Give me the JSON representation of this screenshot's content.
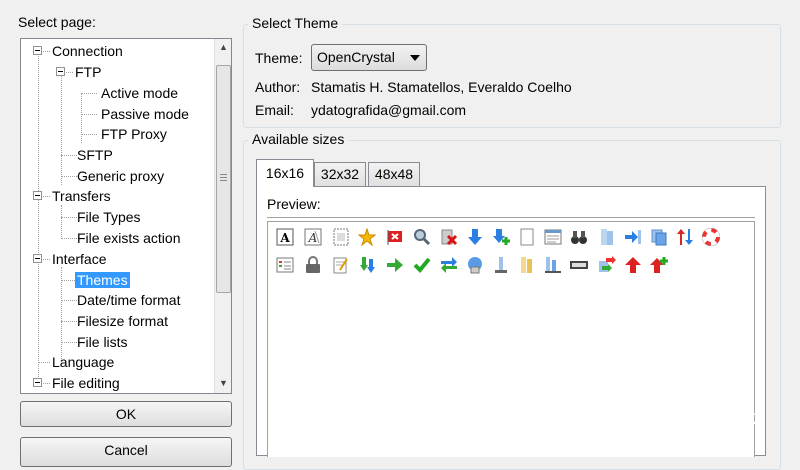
{
  "left": {
    "select_page_label": "Select page:",
    "tree": [
      {
        "label": "Connection"
      },
      {
        "label": "FTP"
      },
      {
        "label": "Active mode"
      },
      {
        "label": "Passive mode"
      },
      {
        "label": "FTP Proxy"
      },
      {
        "label": "SFTP"
      },
      {
        "label": "Generic proxy"
      },
      {
        "label": "Transfers"
      },
      {
        "label": "File Types"
      },
      {
        "label": "File exists action"
      },
      {
        "label": "Interface"
      },
      {
        "label": "Themes"
      },
      {
        "label": "Date/time format"
      },
      {
        "label": "Filesize format"
      },
      {
        "label": "File lists"
      },
      {
        "label": "Language"
      },
      {
        "label": "File editing"
      }
    ],
    "ok_label": "OK",
    "cancel_label": "Cancel"
  },
  "select_theme": {
    "group_title": "Select Theme",
    "theme_label": "Theme:",
    "theme_value": "OpenCrystal",
    "author_label": "Author:",
    "author_value": "Stamatis H. Stamatellos, Everaldo Coelho",
    "email_label": "Email:",
    "email_value": "ydatografida@gmail.com"
  },
  "available_sizes": {
    "group_title": "Available sizes",
    "tabs": [
      {
        "label": "16x16"
      },
      {
        "label": "32x32"
      },
      {
        "label": "48x48"
      }
    ],
    "preview_label": "Preview:",
    "icons_row1": [
      "text-a-icon",
      "text-edit-icon",
      "document-dots-icon",
      "star-icon",
      "flag-icon",
      "search-icon",
      "delete-icon",
      "arrow-down-icon",
      "arrow-down-add-icon",
      "blank-page-icon",
      "list-view-icon",
      "binoculars-icon",
      "upload-icon",
      "forward-icon",
      "copy-icon",
      "sort-icon",
      "lifebuoy-icon"
    ],
    "icons_row2": [
      "details-view-icon",
      "lock-icon",
      "edit-note-icon",
      "sync-down-icon",
      "arrow-right-icon",
      "checkmark-icon",
      "swap-icon",
      "server-icon",
      "bookmark-icon",
      "folder-stack-icon",
      "server-connect-icon",
      "keyboard-icon",
      "transfer-icon",
      "arrow-up-icon",
      "arrow-up-add-icon"
    ]
  },
  "watermark": {
    "text": "MegaProgz"
  }
}
